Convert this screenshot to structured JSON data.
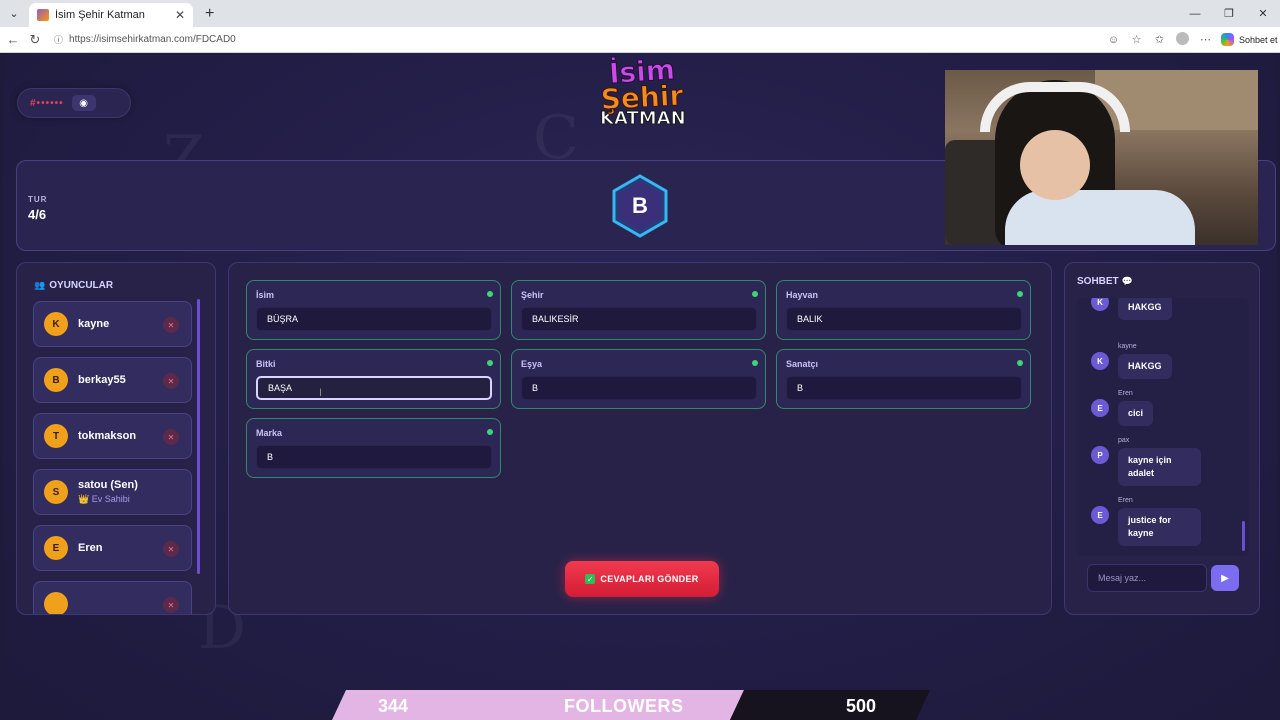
{
  "browser": {
    "tab_title": "İsim Şehir Katman",
    "tab_close": "✕",
    "new_tab": "+",
    "url": "https://isimsehirkatman.com/FDCAD0",
    "copilot_label": "Sohbet et"
  },
  "header": {
    "room_code": "#••••••",
    "logo": {
      "line1": "İsim",
      "line2": "Şehir",
      "line3": "KATMAN"
    }
  },
  "round": {
    "label": "TUR",
    "value": "4/6",
    "letter": "B"
  },
  "players": {
    "title": "OYUNCULAR",
    "list": [
      {
        "initial": "K",
        "name": "kayne"
      },
      {
        "initial": "B",
        "name": "berkay55"
      },
      {
        "initial": "T",
        "name": "tokmakson"
      },
      {
        "initial": "S",
        "name": "satou (Sen)",
        "sub": "Ev Sahibi"
      },
      {
        "initial": "E",
        "name": "Eren"
      }
    ]
  },
  "answers": {
    "fields": [
      {
        "label": "İsim",
        "value": "BÜŞRA"
      },
      {
        "label": "Şehir",
        "value": "BALIKESİR"
      },
      {
        "label": "Hayvan",
        "value": "BALIK"
      },
      {
        "label": "Bitki",
        "value": "BAŞA"
      },
      {
        "label": "Eşya",
        "value": "B"
      },
      {
        "label": "Sanatçı",
        "value": "B"
      },
      {
        "label": "Marka",
        "value": "B"
      }
    ],
    "submit_label": "CEVAPLARI GÖNDER"
  },
  "chat": {
    "title": "SOHBET",
    "messages": [
      {
        "initial": "K",
        "sender": "",
        "text": "HAKGG"
      },
      {
        "initial": "K",
        "sender": "kayne",
        "text": "HAKGG"
      },
      {
        "initial": "E",
        "sender": "Eren",
        "text": "cici"
      },
      {
        "initial": "P",
        "sender": "pax",
        "text": "kayne için adalet"
      },
      {
        "initial": "E",
        "sender": "Eren",
        "text": "justice for kayne"
      }
    ],
    "input_placeholder": "Mesaj yaz..."
  },
  "followers": {
    "current": "344",
    "label": "FOLLOWERS",
    "goal": "500"
  }
}
